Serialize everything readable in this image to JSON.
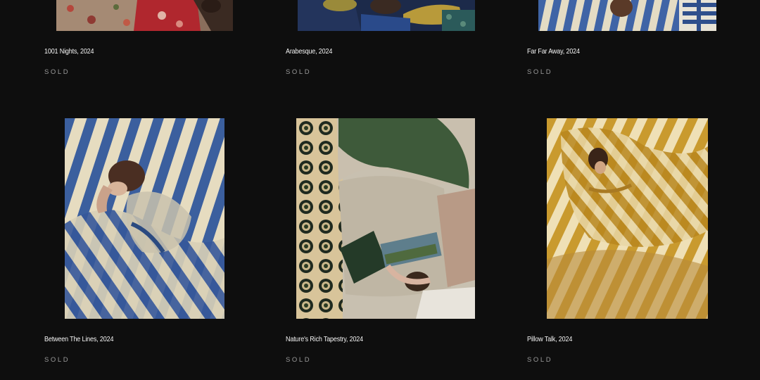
{
  "gallery": {
    "row1": [
      {
        "title": "1001 Nights, 2024",
        "status": "SOLD"
      },
      {
        "title": "Arabesque, 2024",
        "status": "SOLD"
      },
      {
        "title": "Far Far Away, 2024",
        "status": "SOLD"
      }
    ],
    "row2": [
      {
        "title": "Between The Lines, 2024",
        "status": "SOLD"
      },
      {
        "title": "Nature's Rich Tapestry, 2024",
        "status": "SOLD"
      },
      {
        "title": "Pillow Talk, 2024",
        "status": "SOLD"
      }
    ]
  },
  "colors": {
    "background": "#0e0e0e",
    "status_text": "#9a9a9a",
    "stripe_blue": "#3b5f9e",
    "stripe_gold": "#c99a2e"
  }
}
